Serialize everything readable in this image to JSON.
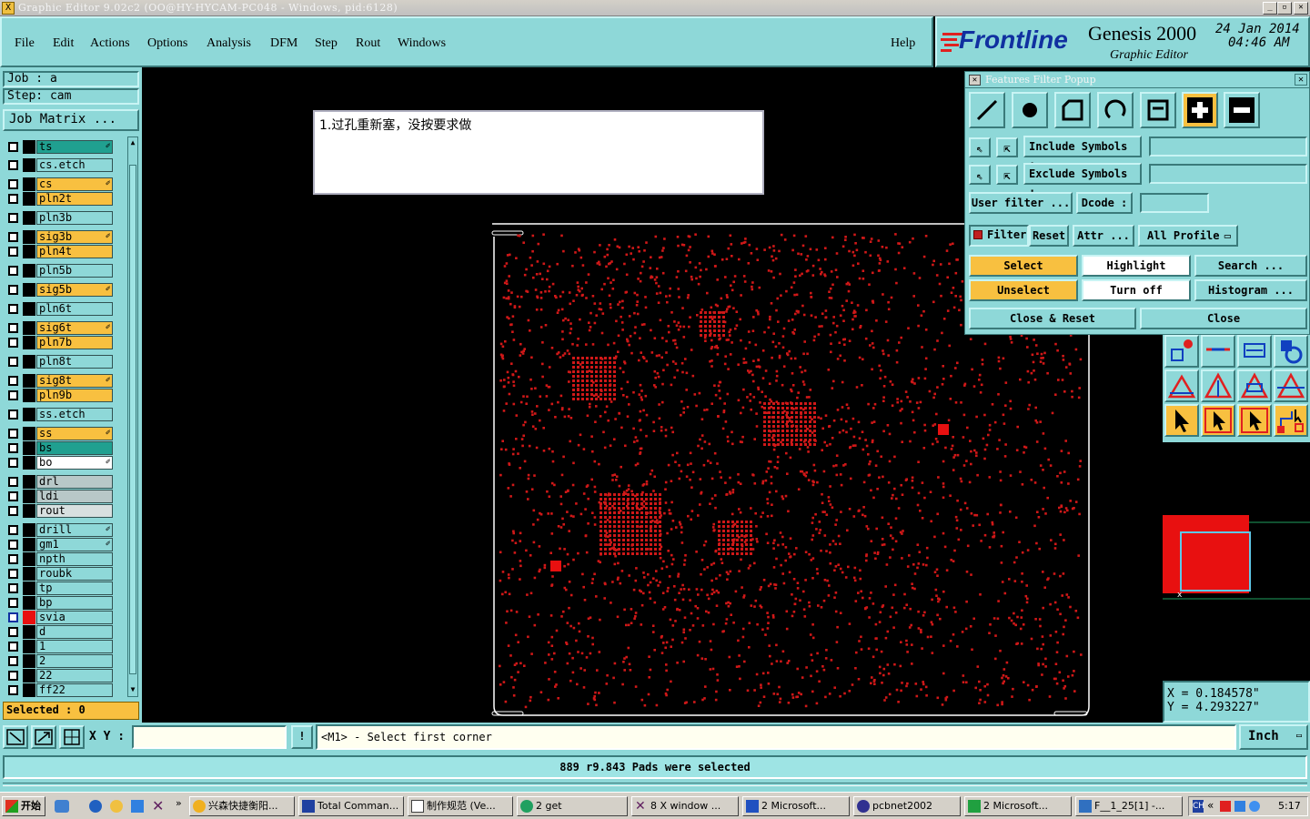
{
  "window": {
    "title": "Graphic Editor 9.02c2  (OO@HY-HYCAM-PC048 - Windows, pid:6128)"
  },
  "menu": {
    "items": [
      "File",
      "Edit",
      "Actions",
      "Options",
      "Analysis",
      "DFM",
      "Step",
      "Rout",
      "Windows"
    ],
    "help": "Help"
  },
  "logo": {
    "brand": "Frontline",
    "product": "Genesis 2000",
    "subtitle": "Graphic Editor",
    "date": "24 Jan 2014",
    "time": "04:46 AM"
  },
  "job": {
    "job_label": "Job  : a",
    "step_label": "Step: cam",
    "matrix_button": "Job Matrix ..."
  },
  "layers": [
    {
      "name": "ts",
      "color": "#20a090",
      "edit": true
    },
    {
      "name": "cs.etch",
      "color": "#8ed8d8",
      "edit": false
    },
    {
      "name": "cs",
      "color": "#f8c040",
      "edit": true
    },
    {
      "name": "pln2t",
      "color": "#f8c040",
      "edit": false
    },
    {
      "name": "pln3b",
      "color": "#8ed8d8",
      "edit": false
    },
    {
      "name": "sig3b",
      "color": "#f8c040",
      "edit": true
    },
    {
      "name": "pln4t",
      "color": "#f8c040",
      "edit": false
    },
    {
      "name": "pln5b",
      "color": "#8ed8d8",
      "edit": false
    },
    {
      "name": "sig5b",
      "color": "#f8c040",
      "edit": true
    },
    {
      "name": "pln6t",
      "color": "#8ed8d8",
      "edit": false
    },
    {
      "name": "sig6t",
      "color": "#f8c040",
      "edit": true
    },
    {
      "name": "pln7b",
      "color": "#f8c040",
      "edit": false
    },
    {
      "name": "pln8t",
      "color": "#8ed8d8",
      "edit": false
    },
    {
      "name": "sig8t",
      "color": "#f8c040",
      "edit": true
    },
    {
      "name": "pln9b",
      "color": "#f8c040",
      "edit": false
    },
    {
      "name": "ss.etch",
      "color": "#8ed8d8",
      "edit": false
    },
    {
      "name": "ss",
      "color": "#f8c040",
      "edit": true
    },
    {
      "name": "bs",
      "color": "#20a090",
      "edit": false
    },
    {
      "name": "bo",
      "color": "#ffffff",
      "edit": true
    },
    {
      "name": "drl",
      "color": "#b8c8c8",
      "edit": false
    },
    {
      "name": "ldi",
      "color": "#b8c8c8",
      "edit": false
    },
    {
      "name": "rout",
      "color": "#d8e0e0",
      "edit": false
    },
    {
      "name": "drill",
      "color": "#8ed8d8",
      "edit": true
    },
    {
      "name": "gm1",
      "color": "#8ed8d8",
      "edit": true
    },
    {
      "name": "npth",
      "color": "#8ed8d8",
      "edit": false
    },
    {
      "name": "roubk",
      "color": "#8ed8d8",
      "edit": false
    },
    {
      "name": "tp",
      "color": "#8ed8d8",
      "edit": false
    },
    {
      "name": "bp",
      "color": "#8ed8d8",
      "edit": false
    },
    {
      "name": "svia",
      "color": "#8ed8d8",
      "edit": false,
      "active": true
    },
    {
      "name": "d",
      "color": "#8ed8d8",
      "edit": false
    },
    {
      "name": "1",
      "color": "#8ed8d8",
      "edit": false
    },
    {
      "name": "2",
      "color": "#8ed8d8",
      "edit": false
    },
    {
      "name": "22",
      "color": "#8ed8d8",
      "edit": false
    },
    {
      "name": "ff22",
      "color": "#8ed8d8",
      "edit": false
    }
  ],
  "selected_label": "Selected : 0",
  "note": "1.过孔重新塞，没按要求做",
  "filter_popup": {
    "title": "Features Filter Popup",
    "include_symbols": "Include Symbols :",
    "exclude_symbols": "Exclude Symbols :",
    "user_filter": "User filter ...",
    "dcode": "Dcode :",
    "filter": "Filter",
    "reset": "Reset",
    "attr": "Attr ...",
    "all_profile": "All Profile",
    "select": "Select",
    "highlight": "Highlight",
    "search": "Search ...",
    "unselect": "Unselect",
    "turn_off": "Turn off",
    "histogram": "Histogram ...",
    "close_reset": "Close & Reset",
    "close": "Close"
  },
  "coords": {
    "x": "X = 0.184578\"",
    "y": "Y = 4.293227\""
  },
  "bottom": {
    "xy_label": "X Y :",
    "xy_value": "",
    "prompt": "<M1> - Select first corner",
    "unit": "Inch",
    "status": "889 r9.843 Pads were selected"
  },
  "taskbar": {
    "start": "开始",
    "tasks": [
      "兴森快捷衡阳...",
      "Total Comman...",
      "制作规范 (Ve...",
      "2 get",
      "8 X window ...",
      "2 Microsoft...",
      "pcbnet2002",
      "2 Microsoft...",
      "F__1_25[1] -..."
    ],
    "clock": "5:17"
  },
  "colors": {
    "panel": "#8ed8d8",
    "feature": "#d01818",
    "highlight": "#f8c040"
  }
}
